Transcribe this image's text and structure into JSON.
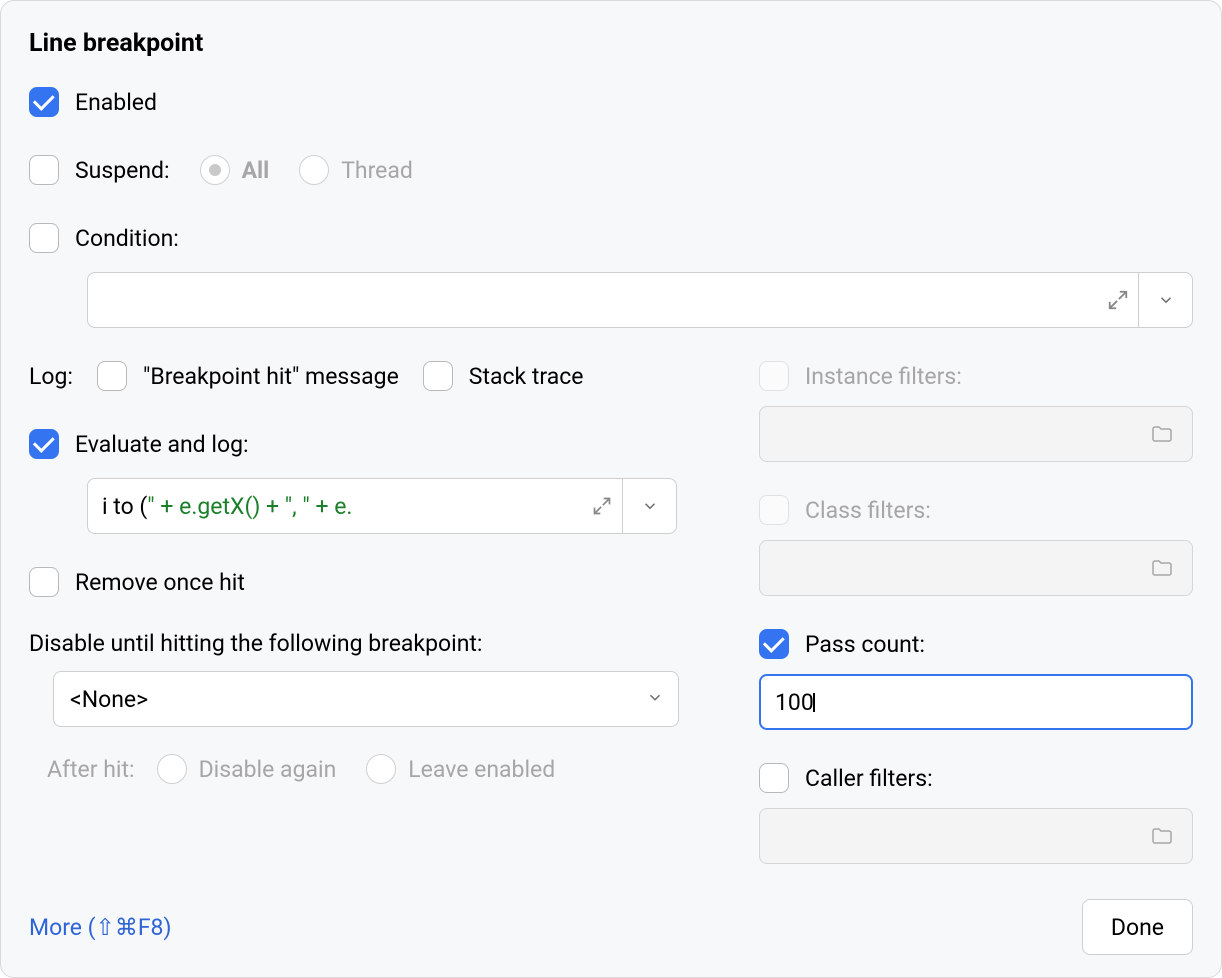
{
  "title": "Line breakpoint",
  "enabled": {
    "label": "Enabled",
    "checked": true
  },
  "suspend": {
    "label": "Suspend:",
    "checked": false,
    "options": {
      "all": "All",
      "thread": "Thread"
    },
    "selected": "all"
  },
  "condition": {
    "label": "Condition:",
    "checked": false,
    "value": ""
  },
  "log": {
    "label": "Log:",
    "breakpointHit": {
      "label": "\"Breakpoint hit\" message",
      "checked": false
    },
    "stackTrace": {
      "label": "Stack trace",
      "checked": false
    }
  },
  "evaluateAndLog": {
    "label": "Evaluate and log:",
    "checked": true,
    "expression_plain": "i to (",
    "expression_str1": "\" + e.getX() + \"",
    "expression_str2": ", ",
    "expression_tail": "\" + e."
  },
  "removeOnceHit": {
    "label": "Remove once hit",
    "checked": false
  },
  "disableUntil": {
    "label": "Disable until hitting the following breakpoint:",
    "selected": "<None>",
    "afterHitLabel": "After hit:",
    "disableAgain": "Disable again",
    "leaveEnabled": "Leave enabled"
  },
  "instanceFilters": {
    "label": "Instance filters:",
    "checked": false,
    "value": ""
  },
  "classFilters": {
    "label": "Class filters:",
    "checked": false,
    "value": ""
  },
  "passCount": {
    "label": "Pass count:",
    "checked": true,
    "value": "100"
  },
  "callerFilters": {
    "label": "Caller filters:",
    "checked": false,
    "value": ""
  },
  "footer": {
    "moreLink": "More (⇧⌘F8)",
    "done": "Done"
  }
}
